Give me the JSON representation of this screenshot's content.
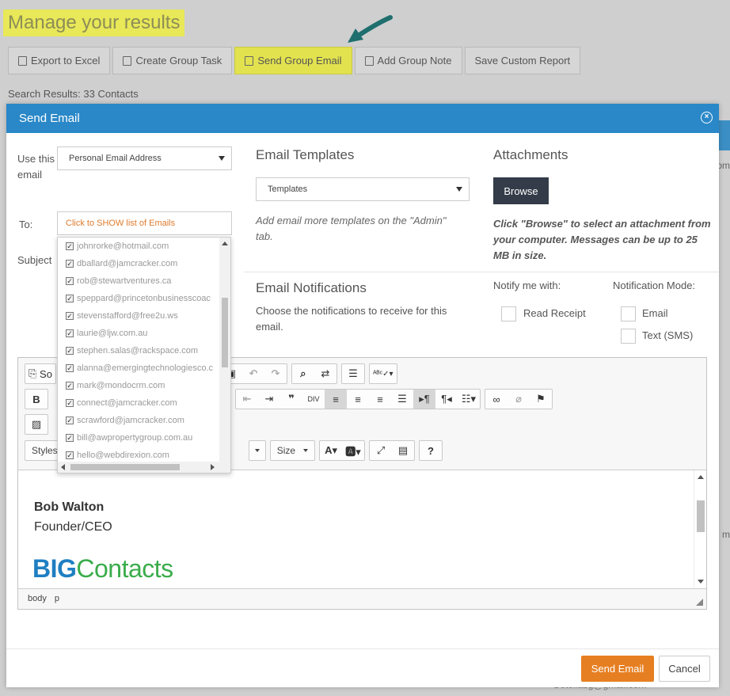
{
  "background": {
    "title": "Manage your results",
    "toolbar": [
      {
        "label": "Export to Excel",
        "icon": "excel-icon"
      },
      {
        "label": "Create Group Task",
        "icon": "task-check-icon"
      },
      {
        "label": "Send Group Email",
        "icon": "envelope-icon"
      },
      {
        "label": "Add Group Note",
        "icon": "edit-note-icon"
      },
      {
        "label": "Save Custom Report",
        "icon": ""
      }
    ],
    "search_results": "Search Results: 33 Contacts",
    "right_fragment_1": "om",
    "right_fragment_2": "m",
    "bottom_fragment": "Getellabg@gmail.com"
  },
  "modal": {
    "title": "Send Email",
    "use_email_label": "Use this email",
    "use_email_value": "Personal Email Address",
    "to_label": "To:",
    "to_placeholder": "Click to SHOW list of Emails",
    "subject_label": "Subject",
    "templates_title": "Email Templates",
    "templates_value": "Templates",
    "templates_hint": "Add email more templates on the \"Admin\" tab.",
    "attachments_title": "Attachments",
    "browse_label": "Browse",
    "attachments_hint": "Click \"Browse\" to select an attachment from your computer. Messages can be up to 25 MB in size.",
    "notifications_title": "Email Notifications",
    "notifications_desc": "Choose the notifications to receive for this email.",
    "notify_me_label": "Notify me with:",
    "read_receipt_label": "Read Receipt",
    "mode_label": "Notification Mode:",
    "mode_email_label": "Email",
    "mode_sms_label": "Text (SMS)",
    "send_label": "Send Email",
    "cancel_label": "Cancel"
  },
  "email_list": [
    "johnrorke@hotmail.com",
    "dballard@jamcracker.com",
    "rob@stewartventures.ca",
    "speppard@princetonbusinesscoac",
    "stevenstafford@free2u.ws",
    "laurie@ljw.com.au",
    "stephen.salas@rackspace.com",
    "alanna@emergingtechnologiesco.c",
    "mark@mondocrm.com",
    "connect@jamcracker.com",
    "scrawford@jamcracker.com",
    "bill@awpropertygroup.com.au",
    "hello@webdirexion.com"
  ],
  "editor": {
    "source_label": "So",
    "styles_label": "Styles",
    "size_label": "Size",
    "bold_label": "B",
    "signature_name": "Bob Walton",
    "signature_title": "Founder/CEO",
    "logo_big": "BIG",
    "logo_contacts": "Contacts",
    "status_body": "body",
    "status_p": "p"
  }
}
